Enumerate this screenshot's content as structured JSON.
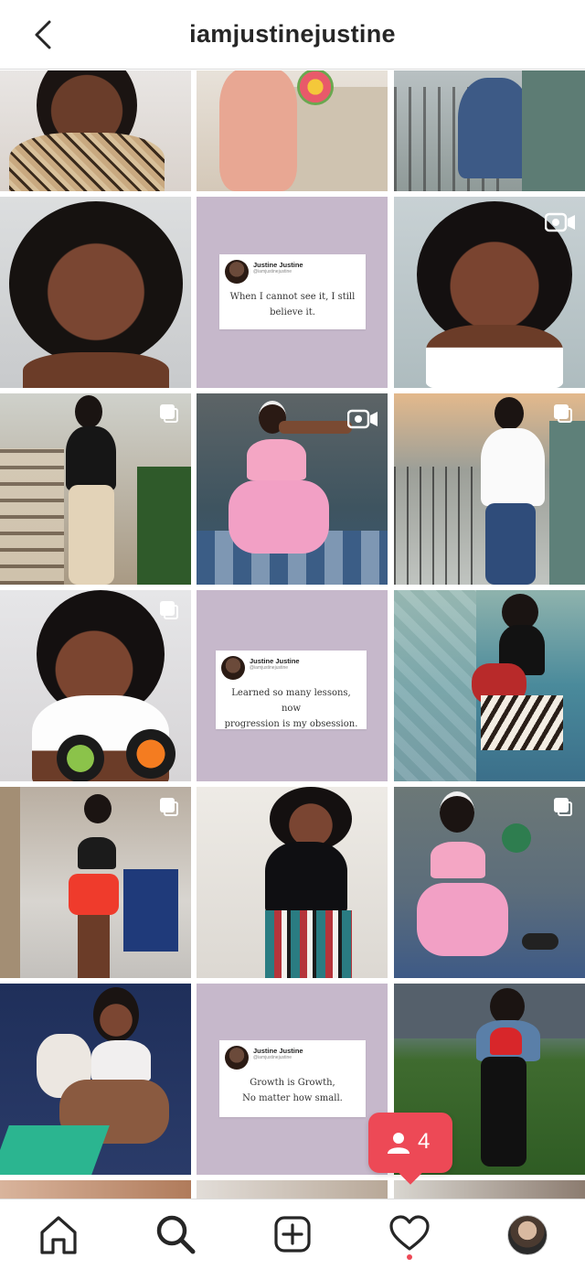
{
  "header": {
    "title": "iamjustinejustine",
    "back_icon": "chevron-left-icon"
  },
  "quotes": [
    {
      "name": "Justine Justine",
      "handle": "@iamjustinejustine",
      "line1": "When I cannot see it, I still",
      "line2": "believe it."
    },
    {
      "name": "Justine Justine",
      "handle": "@iamjustinejustine",
      "line1": "Learned so many lessons, now",
      "line2": "progression is my obsession."
    },
    {
      "name": "Justine Justine",
      "handle": "@iamjustinejustine",
      "line1": "Growth is Growth,",
      "line2": "No matter how small."
    }
  ],
  "notification": {
    "icon": "person-icon",
    "count": "4",
    "color": "#ed4956"
  },
  "tabbar": {
    "items": [
      "home-icon",
      "search-icon",
      "add-post-icon",
      "heart-icon",
      "profile-avatar"
    ]
  },
  "colors": {
    "quote_background": "#c6b8cb",
    "accent": "#ed4956"
  }
}
